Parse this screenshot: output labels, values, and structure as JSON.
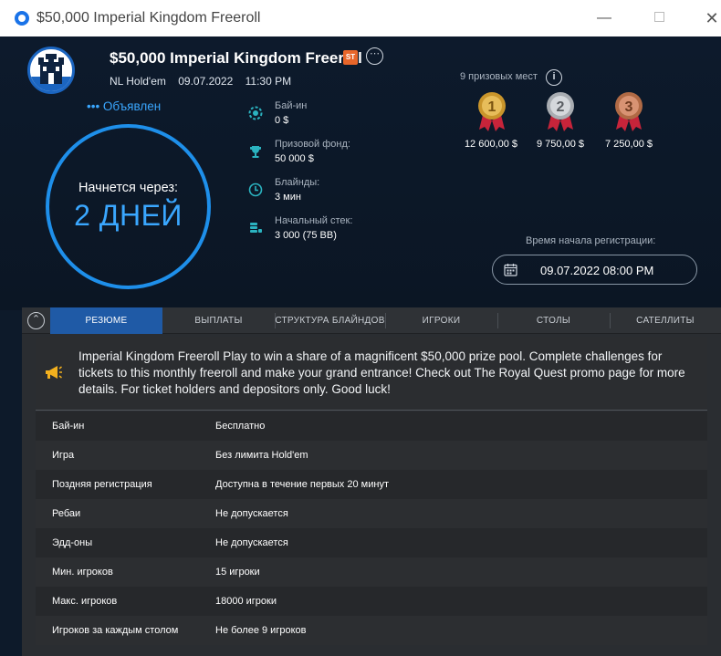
{
  "window": {
    "title": "$50,000 Imperial Kingdom Freeroll"
  },
  "header": {
    "title": "$50,000 Imperial Kingdom Freeroll",
    "badge": "ST",
    "game": "NL Hold'em",
    "date": "09.07.2022",
    "time": "11:30 PM",
    "status": "••• Объявлен",
    "countdown_label": "Начнется через:",
    "countdown_value": "2 ДНЕЙ"
  },
  "info": {
    "buyin_label": "Бай-ин",
    "buyin_value": "0 $",
    "prize_label": "Призовой фонд:",
    "prize_value": "50 000 $",
    "blinds_label": "Блайнды:",
    "blinds_value": "3 мин",
    "stack_label": "Начальный стек:",
    "stack_value": "3 000 (75 BB)"
  },
  "prizes": {
    "count_label": "9 призовых мест",
    "items": [
      {
        "place": "1",
        "value": "12 600,00 $",
        "color": "#c9952b"
      },
      {
        "place": "2",
        "value": "9 750,00 $",
        "color": "#a9adb2"
      },
      {
        "place": "3",
        "value": "7 250,00 $",
        "color": "#b06a45"
      }
    ]
  },
  "registration": {
    "label": "Время начала регистрации:",
    "value": "09.07.2022 08:00 PM"
  },
  "tabs": [
    "РЕЗЮМЕ",
    "ВЫПЛАТЫ",
    "СТРУКТУРА БЛАЙНДОВ",
    "ИГРОКИ",
    "СТОЛЫ",
    "САТЕЛЛИТЫ"
  ],
  "description": "Imperial Kingdom Freeroll Play to win a share of a magnificent $50,000 prize pool. Complete challenges for tickets to this monthly freeroll and make your grand entrance! Check out The Royal Quest promo page for more details. For ticket holders and depositors only. Good luck!",
  "details": [
    {
      "k": "Бай-ин",
      "v": "Бесплатно"
    },
    {
      "k": "Игра",
      "v": "Без лимита Hold'em"
    },
    {
      "k": "Поздняя регистрация",
      "v": "Доступна в течение первых 20 минут"
    },
    {
      "k": "Ребаи",
      "v": "Не допускается"
    },
    {
      "k": "Эдд-оны",
      "v": "Не допускается"
    },
    {
      "k": "Мин. игроков",
      "v": "15 игроки"
    },
    {
      "k": "Макс. игроков",
      "v": "18000 игроки"
    },
    {
      "k": "Игроков за каждым столом",
      "v": "Не более 9 игроков"
    }
  ],
  "colors": {
    "accent": "#1e8fea",
    "tab_active": "#1f5aa6",
    "badge": "#e8662a"
  }
}
